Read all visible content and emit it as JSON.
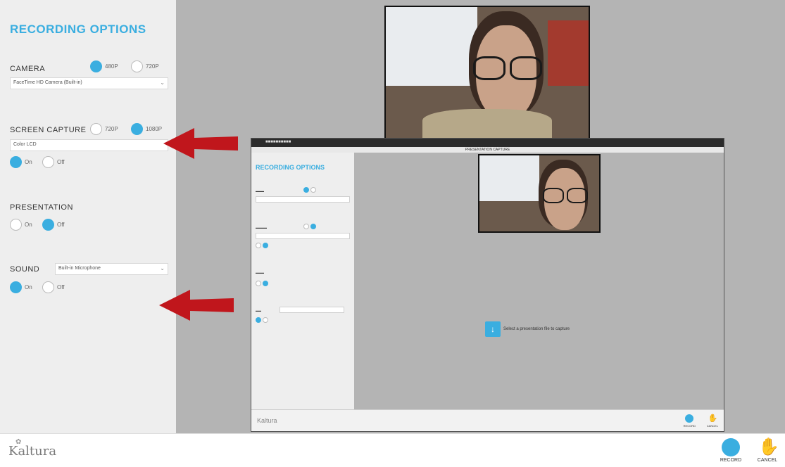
{
  "panel": {
    "title": "RECORDING OPTIONS",
    "camera": {
      "label": "CAMERA",
      "options": [
        "480P",
        "720P"
      ],
      "selected": "480P",
      "device": "FaceTime HD Camera (Built-in)"
    },
    "screen_capture": {
      "label": "SCREEN CAPTURE",
      "options": [
        "720P",
        "1080P"
      ],
      "selected": "1080P",
      "device": "Color LCD",
      "toggle": [
        "On",
        "Off"
      ],
      "toggle_selected": "On"
    },
    "presentation": {
      "label": "PRESENTATION",
      "toggle": [
        "On",
        "Off"
      ],
      "toggle_selected": "Off"
    },
    "sound": {
      "label": "SOUND",
      "device": "Built-in Microphone",
      "toggle": [
        "On",
        "Off"
      ],
      "toggle_selected": "On"
    }
  },
  "inner_window": {
    "subbar_title": "PRESENTATION CAPTURE",
    "panel_title": "RECORDING OPTIONS",
    "presentation_message": "Select a presentation file to capture"
  },
  "footer": {
    "logo": "Kaltura",
    "record_label": "RECORD",
    "cancel_label": "CANCEL"
  },
  "colors": {
    "accent": "#3aaee0",
    "arrow": "#c0161c",
    "panel_bg": "#eeeeee",
    "preview_bg": "#b4b4b4"
  }
}
